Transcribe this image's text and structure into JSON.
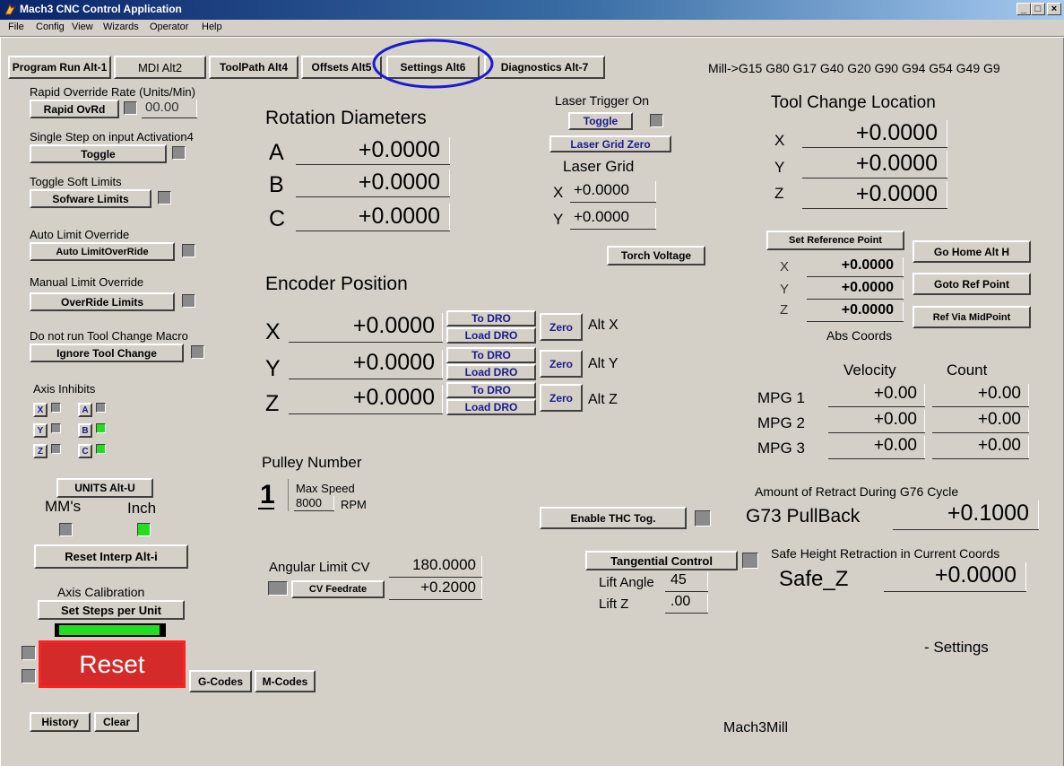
{
  "window": {
    "title": "Mach3 CNC Control Application",
    "min": "_",
    "max": "□",
    "close": "×"
  },
  "menu": [
    "File",
    "Config",
    "View",
    "Wizards",
    "Operator",
    "Help"
  ],
  "tabs": [
    "Program Run Alt-1",
    "MDI Alt2",
    "ToolPath Alt4",
    "Offsets Alt5",
    "Settings Alt6",
    "Diagnostics Alt-7"
  ],
  "active_tab": "Settings Alt6",
  "gcode_status": "Mill->G15  G80 G17 G40 G20 G90 G94 G54 G49 G9",
  "left": {
    "rapid_label": "Rapid Override Rate (Units/Min)",
    "rapid_btn": "Rapid OvRd",
    "rapid_value": "00.00",
    "single_step_label": "Single Step on input Activation4",
    "toggle_btn": "Toggle",
    "soft_limits_label": "Toggle Soft Limits",
    "soft_limits_btn": "Sofware Limits",
    "auto_limit_label": "Auto Limit Override",
    "auto_limit_btn": "Auto LimitOverRide",
    "manual_limit_label": "Manual Limit Override",
    "manual_limit_btn": "OverRide Limits",
    "tool_change_label": "Do not run Tool Change Macro",
    "tool_change_btn": "Ignore Tool Change",
    "axis_inhibits_label": "Axis Inhibits",
    "axes": {
      "x": "X",
      "y": "Y",
      "z": "Z",
      "a": "A",
      "b": "B",
      "c": "C"
    },
    "units_btn": "UNITS Alt-U",
    "mm_label": "MM's",
    "inch_label": "Inch",
    "reset_interp_btn": "Reset Interp Alt-i",
    "axis_cal_label": "Axis Calibration",
    "set_steps_btn": "Set Steps per Unit",
    "reset_btn": "Reset",
    "gcodes_btn": "G-Codes",
    "mcodes_btn": "M-Codes",
    "history_btn": "History",
    "clear_btn": "Clear"
  },
  "rotation": {
    "title": "Rotation Diameters",
    "a_label": "A",
    "a_value": "+0.0000",
    "b_label": "B",
    "b_value": "+0.0000",
    "c_label": "C",
    "c_value": "+0.0000"
  },
  "encoder": {
    "title": "Encoder Position",
    "x_label": "X",
    "x_value": "+0.0000",
    "x_alt": "Alt X",
    "y_label": "Y",
    "y_value": "+0.0000",
    "y_alt": "Alt Y",
    "z_label": "Z",
    "z_value": "+0.0000",
    "z_alt": "Alt Z",
    "to_dro": "To DRO",
    "load_dro": "Load DRO",
    "zero": "Zero"
  },
  "pulley": {
    "title": "Pulley Number",
    "number": "1",
    "max_speed_label": "Max Speed",
    "max_speed": "8000",
    "rpm": "RPM"
  },
  "angular": {
    "label": "Angular Limit CV",
    "value": "180.0000",
    "cv_btn": "CV Feedrate",
    "cv_value": "+0.2000"
  },
  "laser": {
    "trigger_label": "Laser Trigger On",
    "toggle_btn": "Toggle",
    "grid_zero_btn": "Laser Grid Zero",
    "grid_label": "Laser Grid",
    "x_label": "X",
    "x_value": "+0.0000",
    "y_label": "Y",
    "y_value": "+0.0000",
    "torch_btn": "Torch Voltage"
  },
  "thc": {
    "btn": "Enable THC Tog."
  },
  "tangential": {
    "btn": "Tangential Control",
    "lift_angle_label": "Lift Angle",
    "lift_angle": "45",
    "lift_z_label": "Lift Z",
    "lift_z": ".00"
  },
  "tool_change": {
    "title": "Tool Change Location",
    "x_label": "X",
    "x_value": "+0.0000",
    "y_label": "Y",
    "y_value": "+0.0000",
    "z_label": "Z",
    "z_value": "+0.0000"
  },
  "reference": {
    "set_btn": "Set Reference Point",
    "go_home_btn": "Go Home Alt H",
    "goto_ref_btn": "Goto Ref Point",
    "ref_mid_btn": "Ref Via MidPoint",
    "x_label": "X",
    "x_value": "+0.0000",
    "y_label": "Y",
    "y_value": "+0.0000",
    "z_label": "Z",
    "z_value": "+0.0000",
    "abs_coords": "Abs Coords"
  },
  "mpg": {
    "velocity_label": "Velocity",
    "count_label": "Count",
    "rows": [
      {
        "label": "MPG 1",
        "velocity": "+0.00",
        "count": "+0.00"
      },
      {
        "label": "MPG 2",
        "velocity": "+0.00",
        "count": "+0.00"
      },
      {
        "label": "MPG 3",
        "velocity": "+0.00",
        "count": "+0.00"
      }
    ]
  },
  "g73": {
    "label": "Amount of Retract During G76 Cycle",
    "name": "G73 PullBack",
    "value": "+0.1000"
  },
  "safe": {
    "label": "Safe Height Retraction in Current Coords",
    "name": "Safe_Z",
    "value": "+0.0000"
  },
  "screen_name": "- Settings",
  "profile": "Mach3Mill",
  "colors": {
    "title_start": "#0a246a",
    "face": "#d4d0c8",
    "led_on": "#22dd22",
    "reset_red": "#cc2222",
    "highlight_circle": "#1a1ad0"
  }
}
